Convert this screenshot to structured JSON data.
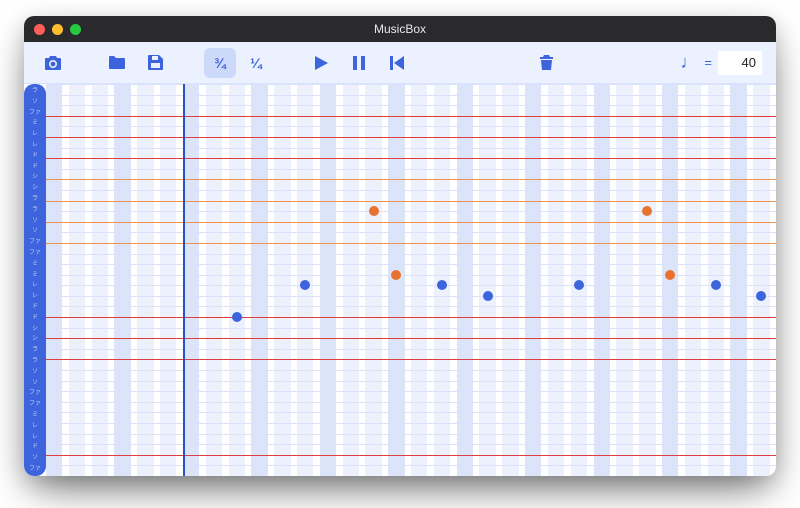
{
  "window": {
    "title": "MusicBox"
  },
  "toolbar": {
    "buttons": {
      "camera": "camera-icon",
      "open": "folder-icon",
      "save": "save-icon",
      "play": "play-icon",
      "pause": "pause-icon",
      "rewind": "rewind-icon",
      "trash": "trash-icon"
    },
    "time_signatures": [
      {
        "label": "¾",
        "active": true
      },
      {
        "label": "¼",
        "active": false
      }
    ],
    "tempo": {
      "note_glyph": "♩",
      "eq": "=",
      "value": "40"
    }
  },
  "ruler": {
    "labels": [
      "ラ",
      "ソ",
      "ファ",
      "ミ",
      "レ",
      "レ",
      "ド",
      "ド",
      "シ",
      "シ",
      "ラ",
      "ラ",
      "ソ",
      "ソ",
      "ファ",
      "ファ",
      "ミ",
      "ミ",
      "レ",
      "レ",
      "ド",
      "ド",
      "シ",
      "シ",
      "ラ",
      "ラ",
      "ソ",
      "ソ",
      "ファ",
      "ファ",
      "ミ",
      "レ",
      "レ",
      "ド",
      "ソ",
      "ファ"
    ]
  },
  "chart_data": {
    "type": "scatter",
    "title": "",
    "beats_per_bar": 3,
    "total_beats": 32,
    "playhead_beat": 6,
    "row_lines": 38,
    "colored_rows": {
      "red": [
        3,
        5,
        7,
        22,
        24,
        26,
        35
      ],
      "orange": [
        9,
        11,
        13,
        15
      ]
    },
    "series": [
      {
        "name": "melody-blue",
        "color": "#3d63dd",
        "points": [
          {
            "beat": 8,
            "row": 22
          },
          {
            "beat": 11,
            "row": 19
          },
          {
            "beat": 17,
            "row": 19
          },
          {
            "beat": 19,
            "row": 20
          },
          {
            "beat": 23,
            "row": 19
          },
          {
            "beat": 29,
            "row": 19
          },
          {
            "beat": 31,
            "row": 20
          }
        ]
      },
      {
        "name": "melody-orange",
        "color": "#e9722f",
        "points": [
          {
            "beat": 14,
            "row": 12
          },
          {
            "beat": 15,
            "row": 18
          },
          {
            "beat": 26,
            "row": 12
          },
          {
            "beat": 27,
            "row": 18
          }
        ]
      }
    ]
  }
}
